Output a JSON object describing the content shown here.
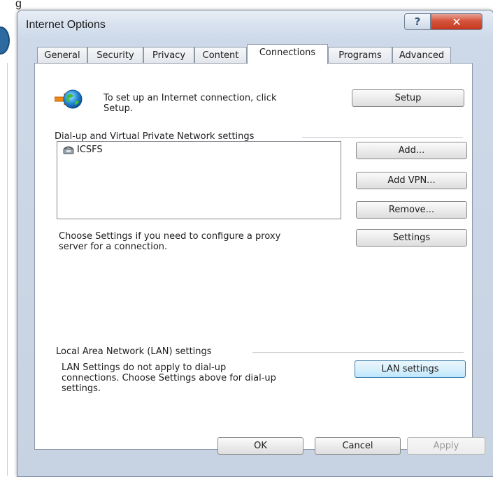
{
  "background": {
    "caption": "g"
  },
  "window": {
    "title": "Internet Options",
    "help_label": "?",
    "close_label": "✕"
  },
  "tabs": [
    {
      "label": "General"
    },
    {
      "label": "Security"
    },
    {
      "label": "Privacy"
    },
    {
      "label": "Content"
    },
    {
      "label": "Connections",
      "active": true
    },
    {
      "label": "Programs"
    },
    {
      "label": "Advanced"
    }
  ],
  "setup_section": {
    "icon": "globe-network-icon",
    "text_line1": "To set up an Internet connection, click",
    "text_line2": "Setup.",
    "setup_button": "Setup"
  },
  "dialup": {
    "heading": "Dial-up and Virtual Private Network settings",
    "connections": [
      {
        "name": "ICSFS",
        "icon": "dialup-phone-icon"
      }
    ],
    "add_button": "Add...",
    "add_vpn_button": "Add VPN...",
    "remove_button": "Remove...",
    "settings_text_line1": "Choose Settings if you need to configure a proxy",
    "settings_text_line2": "server for a connection.",
    "settings_button": "Settings"
  },
  "lan": {
    "heading": "Local Area Network (LAN) settings",
    "text_line1": "LAN Settings do not apply to dial-up",
    "text_line2": "connections. Choose Settings above for dial-up",
    "text_line3": "settings.",
    "lan_button": "LAN settings"
  },
  "footer": {
    "ok": "OK",
    "cancel": "Cancel",
    "apply": "Apply"
  }
}
